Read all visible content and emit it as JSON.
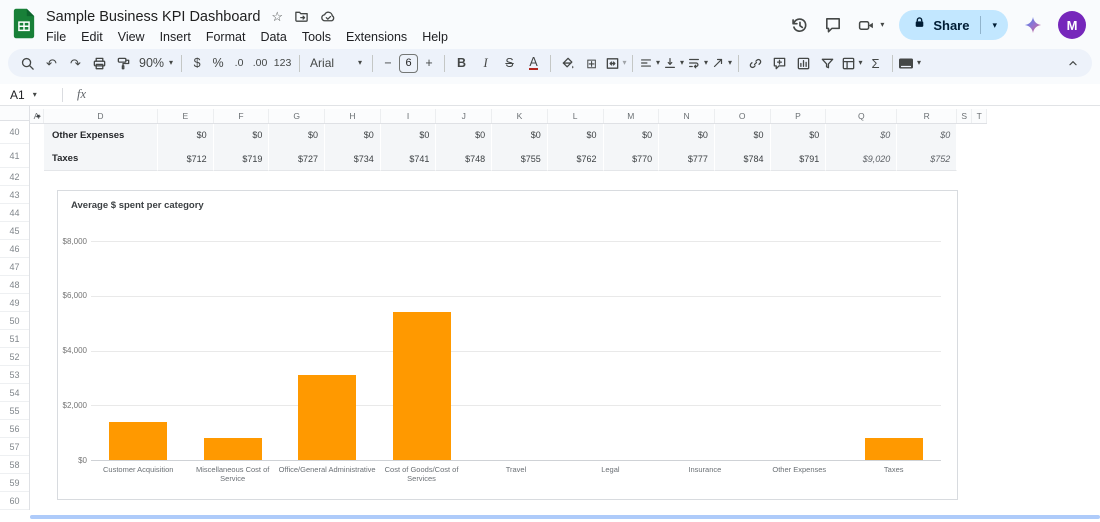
{
  "app": {
    "title": "Sample Business KPI Dashboard",
    "menus": [
      "File",
      "Edit",
      "View",
      "Insert",
      "Format",
      "Data",
      "Tools",
      "Extensions",
      "Help"
    ],
    "share": {
      "label": "Share"
    },
    "avatar_letter": "M"
  },
  "toolbar": {
    "zoom": "90%",
    "currency": "$",
    "percent": "%",
    "decrease_decimals": ".0",
    "increase_decimals": ".00",
    "number_format": "123",
    "font_family": "Arial",
    "decrease_font": "−",
    "font_size": "6",
    "increase_font": "+",
    "bold": "B",
    "italic": "I",
    "strikethrough": "S",
    "text_color": "A",
    "functions": "Σ"
  },
  "icons": {
    "undo": "↶",
    "redo": "↷",
    "borders": "⊞",
    "caret": "▾",
    "star": "☆",
    "hidden_columns": "◂▸"
  },
  "formula_bar": {
    "cell_ref": "A1",
    "fx": "fx"
  },
  "grid": {
    "columns": [
      "A",
      "D",
      "E",
      "F",
      "G",
      "H",
      "I",
      "J",
      "K",
      "L",
      "M",
      "N",
      "O",
      "P",
      "Q",
      "R",
      "S",
      "T"
    ],
    "row_numbers": [
      40,
      41,
      42,
      43,
      44,
      45,
      46,
      47,
      48,
      49,
      50,
      51,
      52,
      53,
      54,
      55,
      56,
      57,
      58,
      59,
      60
    ],
    "data_rows": [
      {
        "row": 40,
        "label": "Other Expenses",
        "values": [
          "$0",
          "$0",
          "$0",
          "$0",
          "$0",
          "$0",
          "$0",
          "$0",
          "$0",
          "$0",
          "$0",
          "$0",
          "$0",
          "$0"
        ],
        "italic_last": 2
      },
      {
        "row": 41,
        "label": "Taxes",
        "values": [
          "$712",
          "$719",
          "$727",
          "$734",
          "$741",
          "$748",
          "$755",
          "$762",
          "$770",
          "$777",
          "$784",
          "$791",
          "$9,020",
          "$752"
        ],
        "italic_last": 2
      }
    ]
  },
  "chart_data": {
    "type": "bar",
    "title": "Average $ spent per category",
    "categories": [
      "Customer Acquisition",
      "Miscellaneous Cost of Service",
      "Office/General Administrative",
      "Cost of Goods/Cost of Services",
      "Travel",
      "Legal",
      "Insurance",
      "Other Expenses",
      "Taxes"
    ],
    "values": [
      1400,
      800,
      3100,
      5400,
      0,
      0,
      0,
      0,
      800
    ],
    "yticks": [
      "$0",
      "$2,000",
      "$4,000",
      "$6,000",
      "$8,000"
    ],
    "ylim": [
      0,
      8000
    ],
    "xlabel": "",
    "ylabel": "",
    "legend": "none",
    "grid": true,
    "bar_color": "#ff9900"
  },
  "colors": {
    "bar": "#ff9900",
    "share_bg": "#c2e7ff",
    "share_text": "#001d35",
    "avatar_bg": "#7627bb",
    "toolbar_bg": "#edf2fa",
    "band_bg": "#f4f6f8",
    "logo_green": "#188038"
  }
}
